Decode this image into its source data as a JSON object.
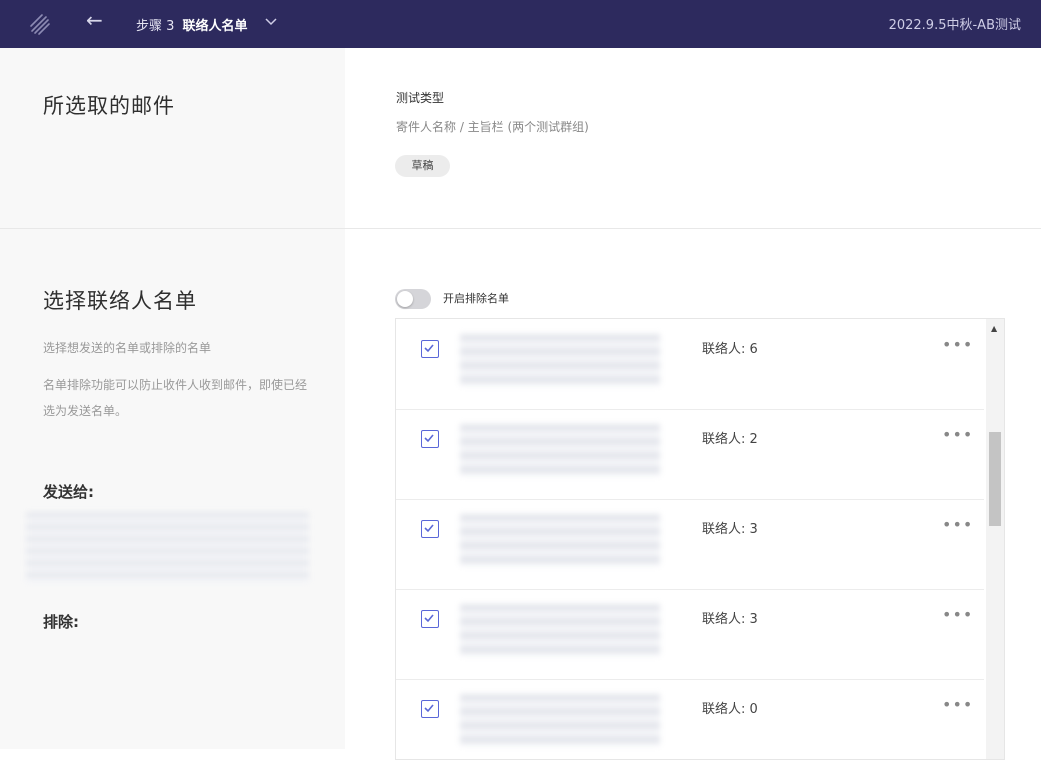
{
  "topbar": {
    "step_num": "步骤 3",
    "step_title": "联络人名单",
    "campaign_name": "2022.9.5中秋-AB测试",
    "logo_icon": "brand-logo-icon",
    "back_icon": "arrow-left-icon",
    "dropdown_icon": "chevron-down-icon"
  },
  "mail_section": {
    "title": "所选取的邮件",
    "type_label": "测试类型",
    "type_value": "寄件人名称 / 主旨栏 (两个测试群组)",
    "status_badge": "草稿"
  },
  "contacts_section": {
    "title": "选择联络人名单",
    "desc1": "选择想发送的名单或排除的名单",
    "desc2": "名单排除功能可以防止收件人收到邮件，即使已经选为发送名单。",
    "send_to_label": "发送给:",
    "exclude_label": "排除:",
    "toggle_label": "开启排除名单",
    "toggle_on": false
  },
  "lists": [
    {
      "count": "联络人: 6",
      "checked": true
    },
    {
      "count": "联络人: 2",
      "checked": true
    },
    {
      "count": "联络人: 3",
      "checked": true
    },
    {
      "count": "联络人: 3",
      "checked": true
    },
    {
      "count": "联络人: 0",
      "checked": true
    }
  ],
  "colors": {
    "topbar_bg": "#2d2a5e",
    "accent": "#5a67d8"
  }
}
